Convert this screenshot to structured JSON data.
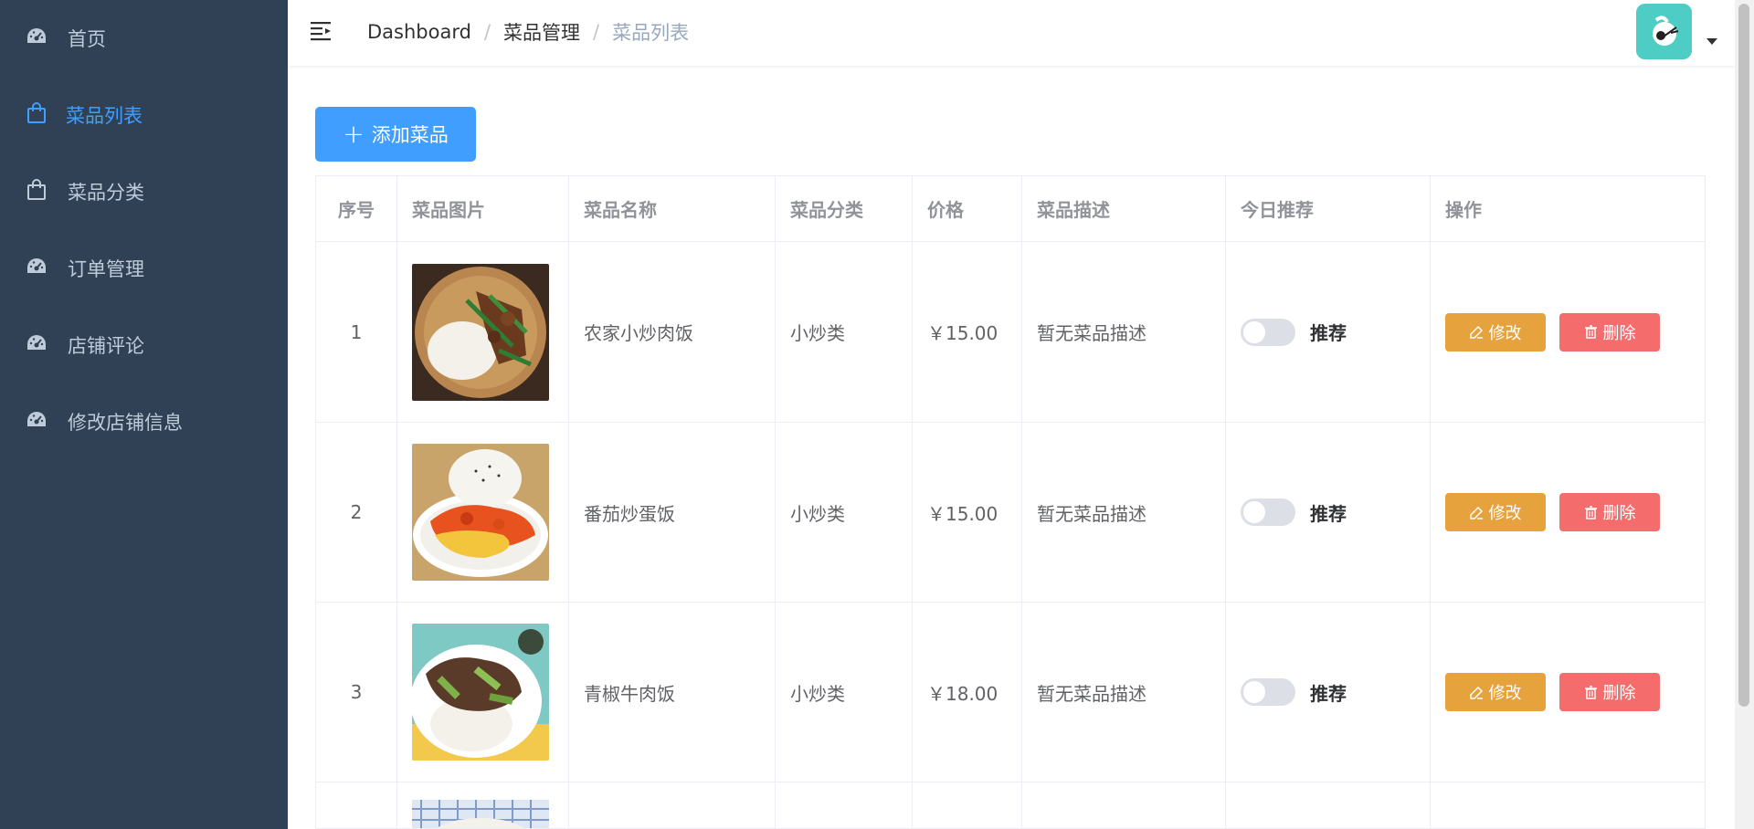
{
  "sidebar": {
    "items": [
      {
        "label": "首页",
        "icon": "dashboard-icon",
        "active": false
      },
      {
        "label": "菜品列表",
        "icon": "shopping-bag-icon",
        "active": true
      },
      {
        "label": "菜品分类",
        "icon": "shopping-bag-icon",
        "active": false
      },
      {
        "label": "订单管理",
        "icon": "dashboard-icon",
        "active": false
      },
      {
        "label": "店铺评论",
        "icon": "dashboard-icon",
        "active": false
      },
      {
        "label": "修改店铺信息",
        "icon": "dashboard-icon",
        "active": false
      }
    ]
  },
  "header": {
    "breadcrumb": [
      "Dashboard",
      "菜品管理",
      "菜品列表"
    ]
  },
  "toolbar": {
    "add_label": "添加菜品"
  },
  "table": {
    "columns": [
      "序号",
      "菜品图片",
      "菜品名称",
      "菜品分类",
      "价格",
      "菜品描述",
      "今日推荐",
      "操作"
    ],
    "rows": [
      {
        "index": "1",
        "name": "农家小炒肉饭",
        "category": "小炒类",
        "price": "￥15.00",
        "description": "暂无菜品描述",
        "recommend_label": "推荐",
        "recommended": false,
        "edit_label": "修改",
        "delete_label": "删除"
      },
      {
        "index": "2",
        "name": "番茄炒蛋饭",
        "category": "小炒类",
        "price": "￥15.00",
        "description": "暂无菜品描述",
        "recommend_label": "推荐",
        "recommended": false,
        "edit_label": "修改",
        "delete_label": "删除"
      },
      {
        "index": "3",
        "name": "青椒牛肉饭",
        "category": "小炒类",
        "price": "￥18.00",
        "description": "暂无菜品描述",
        "recommend_label": "推荐",
        "recommended": false,
        "edit_label": "修改",
        "delete_label": "删除"
      }
    ]
  },
  "colors": {
    "sidebar_bg": "#304156",
    "accent": "#409eff",
    "warning": "#e6a23c",
    "danger": "#f56c6c"
  }
}
